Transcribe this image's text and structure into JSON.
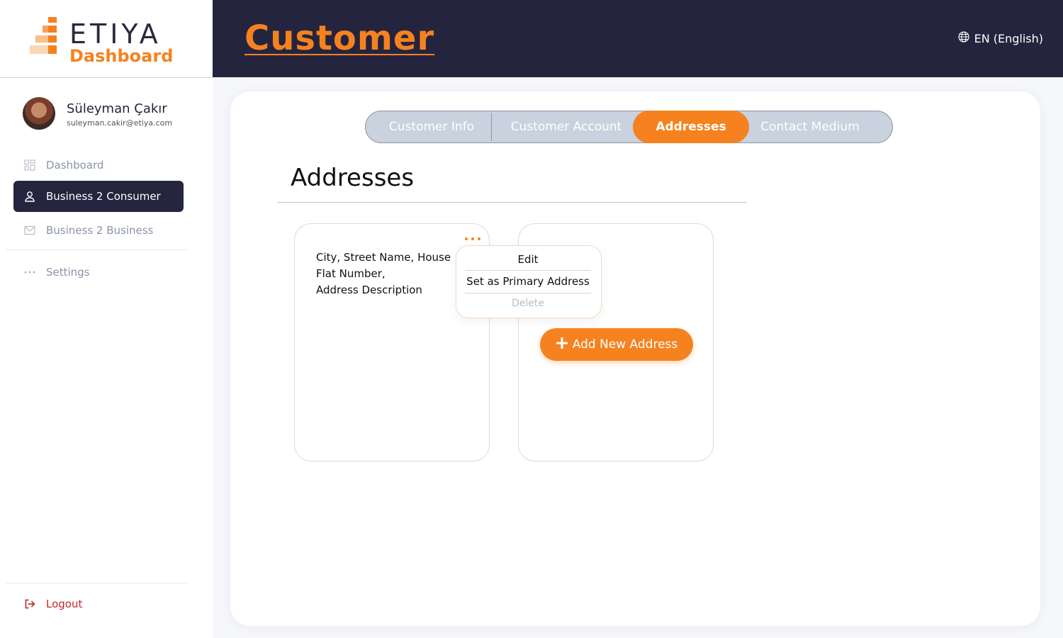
{
  "brand": {
    "name": "ETIYA",
    "subtitle": "Dashboard"
  },
  "user": {
    "name": "Süleyman Çakır",
    "email": "suleyman.cakir@etiya.com"
  },
  "sidebar": {
    "items": [
      {
        "label": "Dashboard",
        "icon": "grid-icon"
      },
      {
        "label": "Business 2 Consumer",
        "icon": "user-icon",
        "active": true
      },
      {
        "label": "Business 2 Business",
        "icon": "mail-icon"
      },
      {
        "label": "Settings",
        "icon": "more-icon"
      }
    ],
    "logout": "Logout"
  },
  "header": {
    "title": "Customer",
    "language": "EN (English)"
  },
  "tabs": [
    "Customer Info",
    "Customer Account",
    "Addresses",
    "Contact Medium"
  ],
  "active_tab": "Addresses",
  "section": {
    "title": "Addresses"
  },
  "address_card": {
    "line1": "City, Street Name, House",
    "line2": "Flat Number,",
    "line3": "Address Description"
  },
  "context_menu": {
    "edit": "Edit",
    "set_primary": "Set as Primary Address",
    "delete": "Delete"
  },
  "add_button": "Add New Address",
  "colors": {
    "accent": "#f5821f",
    "navy": "#25243f",
    "tab_bg": "#c9d2de",
    "logout": "#c0282d"
  }
}
